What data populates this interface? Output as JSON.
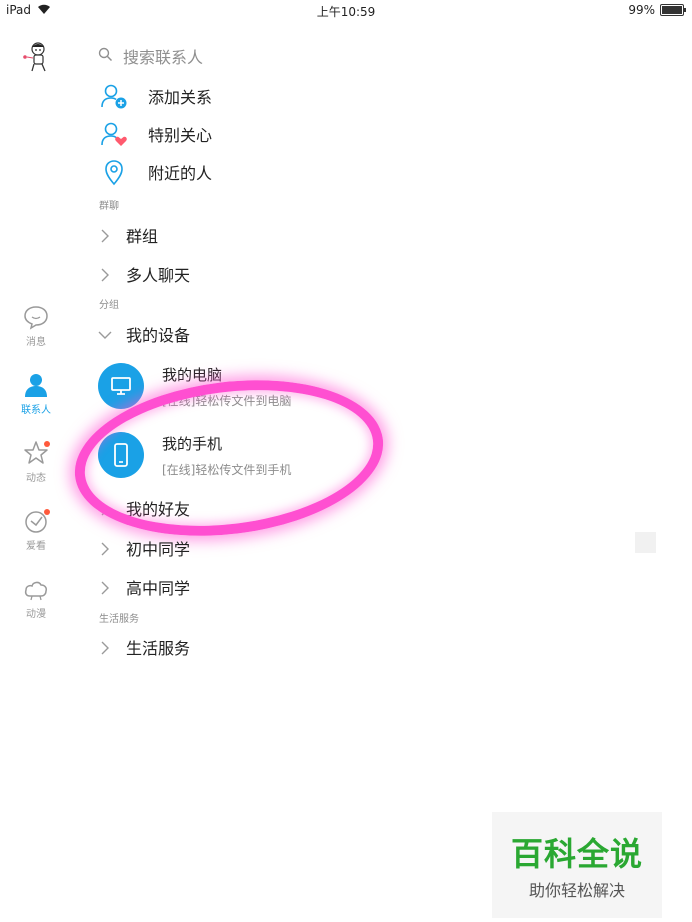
{
  "status_bar": {
    "device": "iPad",
    "time": "上午10:59",
    "battery": "99%",
    "battery_level": 0.99
  },
  "rail": {
    "items": [
      {
        "label": "消息",
        "icon": "chat-bubble-icon"
      },
      {
        "label": "联系人",
        "icon": "person-icon",
        "active": true
      },
      {
        "label": "动态",
        "icon": "star-icon",
        "badge": true
      },
      {
        "label": "爱看",
        "icon": "look-icon",
        "badge": true
      },
      {
        "label": "动漫",
        "icon": "cloud-icon"
      }
    ]
  },
  "search": {
    "placeholder": "搜索联系人"
  },
  "quick_actions": [
    {
      "label": "添加关系",
      "icon": "add-person-icon"
    },
    {
      "label": "特别关心",
      "icon": "person-heart-icon"
    },
    {
      "label": "附近的人",
      "icon": "location-pin-icon"
    }
  ],
  "sections": {
    "group_chat": {
      "title": "群聊",
      "items": [
        "群组",
        "多人聊天"
      ]
    },
    "groups": {
      "title": "分组",
      "my_devices": "我的设备",
      "devices": [
        {
          "name": "我的电脑",
          "status": "[在线]轻松传文件到电脑",
          "icon": "monitor-icon"
        },
        {
          "name": "我的手机",
          "status": "[在线]轻松传文件到手机",
          "icon": "phone-icon"
        }
      ],
      "hidden_group": "我的好友",
      "items": [
        "初中同学",
        "高中同学"
      ]
    },
    "life": {
      "title": "生活服务",
      "items": [
        "生活服务"
      ]
    }
  },
  "colors": {
    "accent": "#1aa1e6",
    "highlight": "#ff4fd1",
    "badge": "#ff5a3c"
  },
  "watermark": {
    "title": "百科全说",
    "subtitle": "助你轻松解决"
  }
}
